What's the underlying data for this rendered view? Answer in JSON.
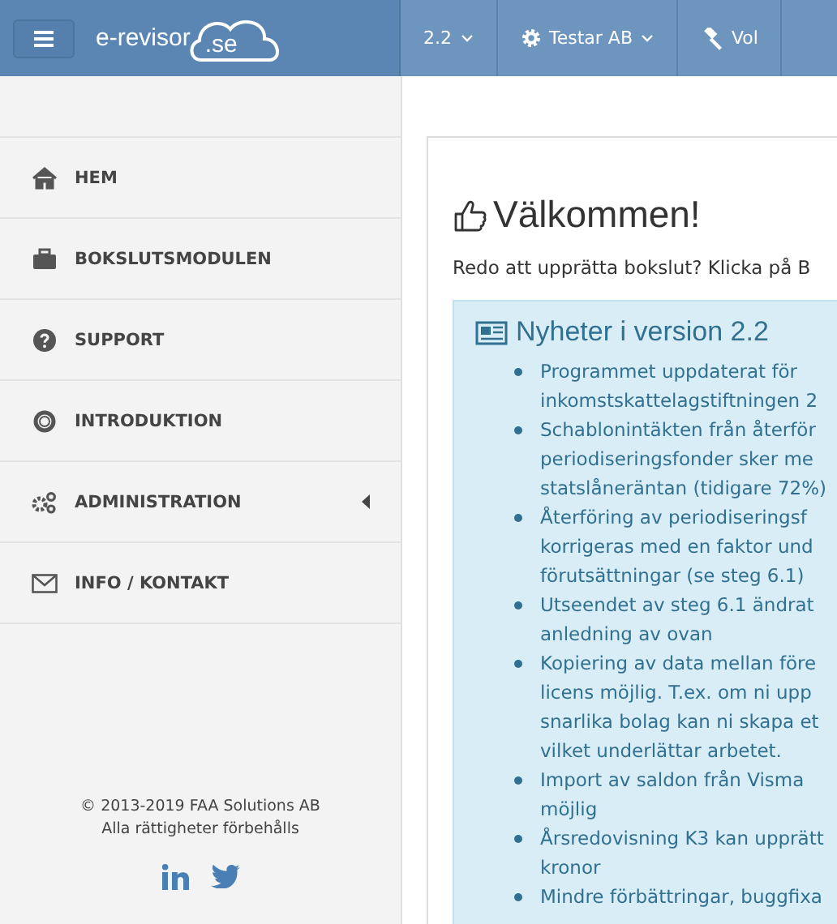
{
  "header": {
    "logo_text": "e-revisor",
    "logo_badge": ".se",
    "nav": [
      {
        "label": "2.2",
        "kind": "plain",
        "dropdown": true
      },
      {
        "label": "Testar AB",
        "kind": "company",
        "dropdown": true
      },
      {
        "label": "Vol",
        "kind": "volume",
        "dropdown": false
      }
    ]
  },
  "sidebar": {
    "items": [
      {
        "label": "HEM",
        "kind": "home",
        "has_submenu": false
      },
      {
        "label": "BOKSLUTSMODULEN",
        "kind": "closing",
        "has_submenu": false
      },
      {
        "label": "SUPPORT",
        "kind": "support",
        "has_submenu": false
      },
      {
        "label": "INTRODUKTION",
        "kind": "intro",
        "has_submenu": false
      },
      {
        "label": "ADMINISTRATION",
        "kind": "admin",
        "has_submenu": true
      },
      {
        "label": "INFO / KONTAKT",
        "kind": "contact",
        "has_submenu": false
      }
    ],
    "footer": [
      "© 2013-2019 FAA Solutions AB",
      "Alla rättigheter förbehålls"
    ]
  },
  "main": {
    "title": "Välkommen!",
    "intro": "Redo att upprätta bokslut? Klicka på B",
    "news": {
      "title": "Nyheter i version 2.2",
      "items": [
        [
          "Programmet uppdaterat för",
          "inkomstskattelagstiftningen 2"
        ],
        [
          "Schablonintäkten från återför",
          "periodiseringsfonder sker me",
          "statslåneräntan (tidigare 72%)"
        ],
        [
          "Återföring av periodiseringsf",
          "korrigeras med en faktor und",
          "förutsättningar (se steg 6.1)"
        ],
        [
          "Utseendet av steg 6.1 ändrat",
          "anledning av ovan"
        ],
        [
          "Kopiering av data mellan före",
          "licens möjlig. T.ex. om ni upp",
          "snarlika bolag kan ni skapa et",
          "vilket underlättar arbetet."
        ],
        [
          "Import av saldon från Visma",
          "möjlig"
        ],
        [
          "Årsredovisning K3 kan upprätt",
          "kronor"
        ],
        [
          "Mindre förbättringar, buggfixa"
        ]
      ]
    }
  }
}
